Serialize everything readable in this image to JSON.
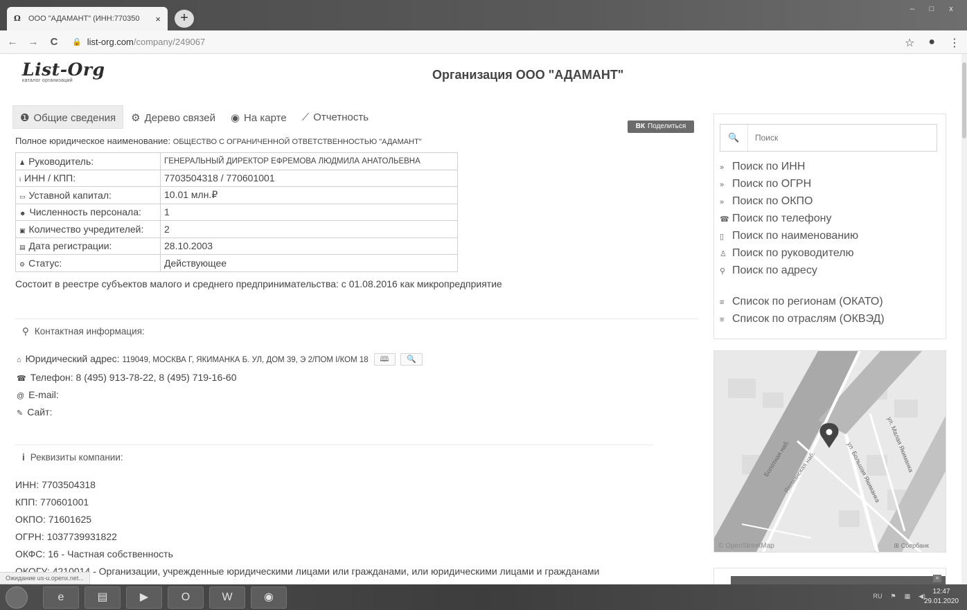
{
  "browser": {
    "tab_title": "ООО \"АДАМАНТ\" (ИНН:770350",
    "tab_close": "×",
    "new_tab": "+",
    "url_host": "list-org.com",
    "url_path": "/company/249067",
    "back": "←",
    "forward": "→",
    "reload": "C",
    "star": "☆",
    "menu": "⋮",
    "account": "●",
    "win_min": "–",
    "win_max": "□",
    "win_close": "x"
  },
  "logo": {
    "name": "List-Org",
    "subtitle": "каталог организаций"
  },
  "page_title": "Организация ООО \"АДАМАНТ\"",
  "tabs": [
    {
      "icon": "info-icon",
      "glyph": "❶",
      "label": "Общие сведения"
    },
    {
      "icon": "cogs-icon",
      "glyph": "⚙",
      "label": "Дерево связей"
    },
    {
      "icon": "globe-icon",
      "glyph": "◉",
      "label": "На карте"
    },
    {
      "icon": "chart-icon",
      "glyph": "⟋",
      "label": "Отчетность"
    }
  ],
  "share_button": {
    "vk": "ВК",
    "label": "Поделиться"
  },
  "full_name": {
    "label": "Полное юридическое наименование:",
    "value": "ОБЩЕСТВО С ОГРАНИЧЕННОЙ ОТВЕТСТВЕННОСТЬЮ \"АДАМАНТ\""
  },
  "info_rows": [
    {
      "icon": "user-icon",
      "glyph": "♟",
      "key": "Руководитель:",
      "value": "ГЕНЕРАЛЬНЫЙ ДИРЕКТОР ЕФРЕМОВА ЛЮДМИЛА АНАТОЛЬЕВНА"
    },
    {
      "icon": "info-icon",
      "glyph": "i",
      "key": "ИНН / КПП:",
      "value": "7703504318 / 770601001"
    },
    {
      "icon": "money-icon",
      "glyph": "▭",
      "key": "Уставной капитал:",
      "value": "10.01 млн.₽"
    },
    {
      "icon": "users-icon",
      "glyph": "☻",
      "key": "Численность персонала:",
      "value": "1"
    },
    {
      "icon": "founders-icon",
      "glyph": "▣",
      "key": "Количество учредителей:",
      "value": "2"
    },
    {
      "icon": "calendar-icon",
      "glyph": "▤",
      "key": "Дата регистрации:",
      "value": "28.10.2003"
    },
    {
      "icon": "status-icon",
      "glyph": "⚙",
      "key": "Статус:",
      "value": "Действующее"
    }
  ],
  "smp_note": "Состоит в реестре субъектов малого и среднего предпринимательства: с 01.08.2016 как микропредприятие",
  "contacts": {
    "heading": "Контактная информация:",
    "address_label": "Юридический адрес:",
    "address_value": "119049, МОСКВА Г, ЯКИМАНКА Б. УЛ, ДОМ 39, Э 2/ПОМ I/КОМ 18",
    "map_button": "🕮",
    "search_button": "🔍",
    "phone": "Телефон: 8 (495) 913-78-22, 8 (495) 719-16-60",
    "email": "E-mail:",
    "site": "Сайт:"
  },
  "requisites": {
    "heading": "Реквизиты компании:",
    "lines": [
      "ИНН: 7703504318",
      "КПП: 770601001",
      "ОКПО: 71601625",
      "ОГРН: 1037739931822",
      "ОКФС: 16 - Частная собственность",
      "ОКОГУ: 4210014 - Организации, учрежденные юридическими лицами или гражданами, или юридическими лицами и гражданами"
    ]
  },
  "sidebar": {
    "search_placeholder": "Поиск",
    "items": [
      {
        "icon": "chevron-icon",
        "glyph": "»",
        "label": "Поиск по ИНН"
      },
      {
        "icon": "chevron-icon",
        "glyph": "»",
        "label": "Поиск по ОГРН"
      },
      {
        "icon": "chevron-icon",
        "glyph": "»",
        "label": "Поиск по ОКПО"
      },
      {
        "icon": "phone-icon",
        "glyph": "☎",
        "label": "Поиск по телефону"
      },
      {
        "icon": "document-icon",
        "glyph": "▯",
        "label": "Поиск по наименованию"
      },
      {
        "icon": "person-icon",
        "glyph": "♙",
        "label": "Поиск по руководителю"
      },
      {
        "icon": "map-marker-icon",
        "glyph": "⚲",
        "label": "Поиск по адресу"
      }
    ],
    "lists": [
      {
        "icon": "list-icon",
        "glyph": "≡",
        "label": "Список по регионам (ОКАТО)"
      },
      {
        "icon": "list-icon",
        "glyph": "≡",
        "label": "Список по отраслям (ОКВЭД)"
      }
    ]
  },
  "map": {
    "credit_left": "© OpenStreetMap",
    "credit_right": "⊞ Сбербанк",
    "streets": [
      "Болотная наб.",
      "ул. Большая Якиманка",
      "ул. Малая Якиманка",
      "Якиманская наб."
    ]
  },
  "status_text": "Ожидание us-u.openx.net...",
  "taskbar": {
    "apps": [
      "e",
      "▤",
      "▶",
      "O",
      "W",
      "◉"
    ],
    "lang": "RU",
    "time": "12:47",
    "date": "29.01.2020"
  }
}
